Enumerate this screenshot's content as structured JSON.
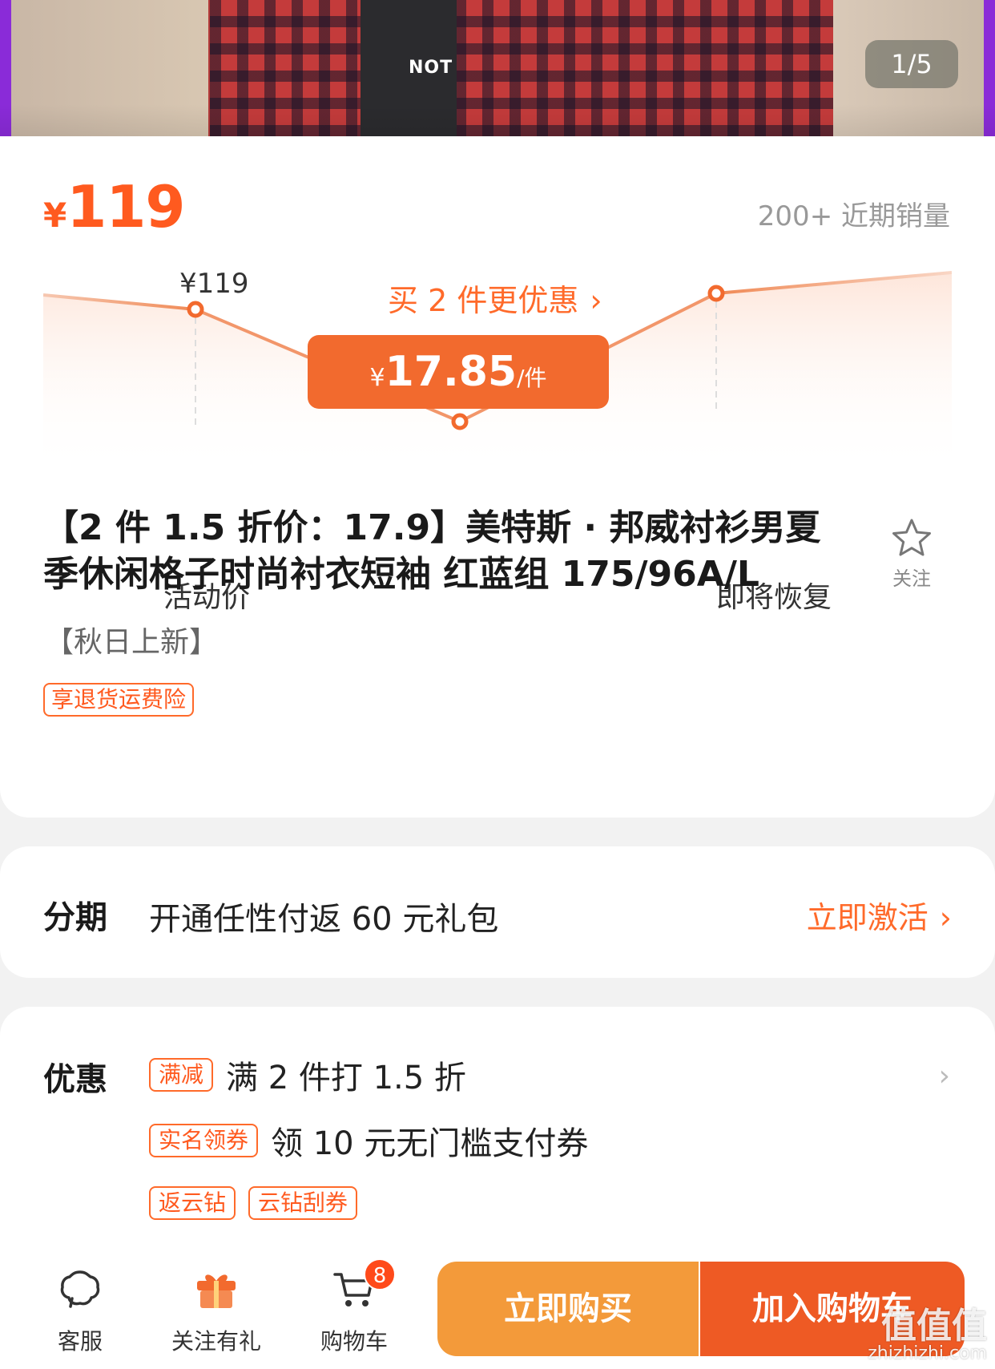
{
  "gallery": {
    "index": "1/5",
    "shirt_print": "NOT"
  },
  "price": {
    "currency": "¥",
    "amount": "119",
    "sales": "200+ 近期销量"
  },
  "price_trend": {
    "left_label": "¥119",
    "left_caption": "活动价",
    "right_caption": "即将恢复",
    "buy_more": "买 2 件更优惠",
    "deal_currency": "¥",
    "deal_value": "17.85",
    "deal_unit": "/件",
    "accent": "#f26a2e"
  },
  "product": {
    "title": "【2 件 1.5 折价：17.9】美特斯 · 邦威衬衫男夏季休闲格子时尚衬衣短袖 红蓝组 175/96A/L",
    "subtitle": "【秋日上新】",
    "tag": "享退货运费险",
    "favorite_label": "关注"
  },
  "installment": {
    "label": "分期",
    "text": "开通任性付返 60 元礼包",
    "action": "立即激活"
  },
  "promo": {
    "label": "优惠",
    "rows": [
      {
        "tag": "满减",
        "text": "满 2 件打 1.5 折"
      },
      {
        "tag": "实名领券",
        "text": "领 10 元无门槛支付券"
      }
    ],
    "extra_tags": [
      "返云钻",
      "云钻刮券"
    ]
  },
  "bottom_bar": {
    "service": "客服",
    "follow_gift": "关注有礼",
    "cart": "购物车",
    "cart_count": "8",
    "buy_now": "立即购买",
    "add_to_cart": "加入购物车"
  },
  "watermark": {
    "logo": "值值值",
    "url": "zhizhizhi.com"
  }
}
